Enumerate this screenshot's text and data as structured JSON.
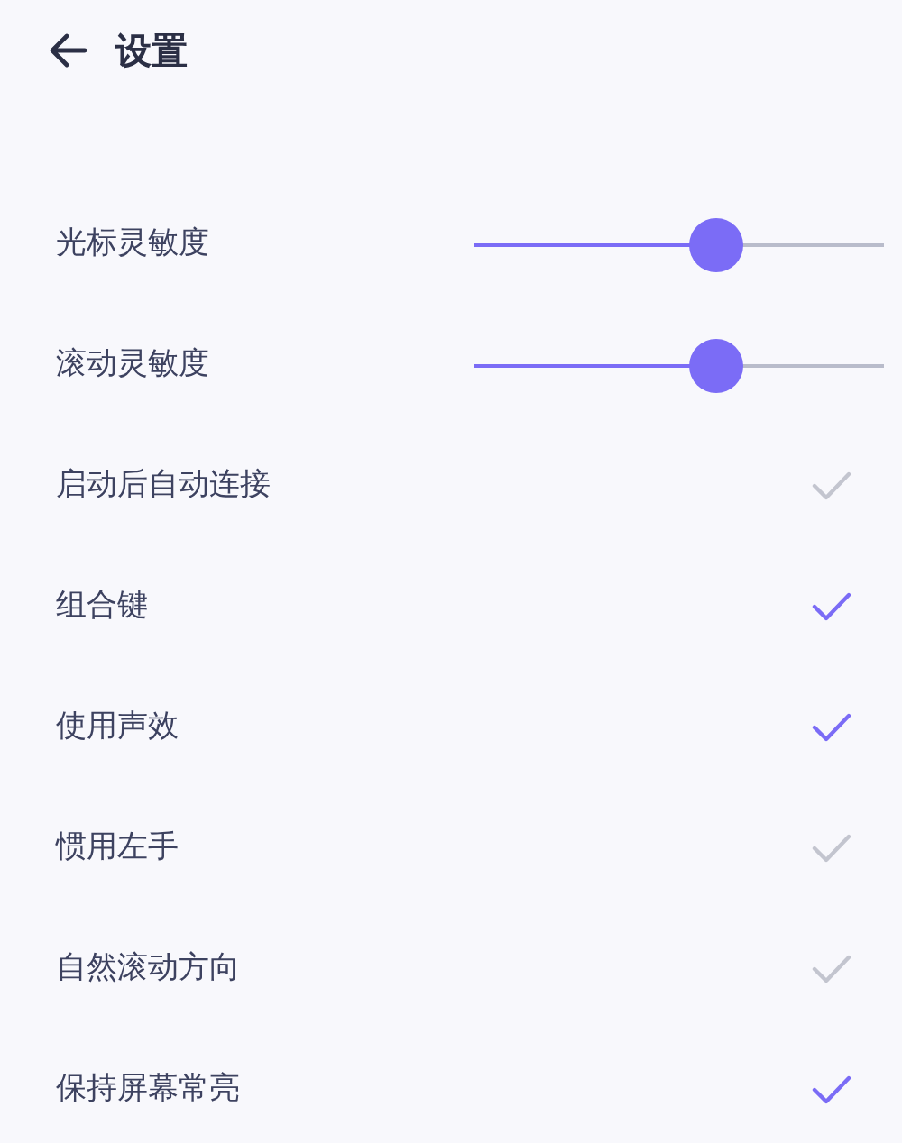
{
  "header": {
    "title": "设置"
  },
  "settings": [
    {
      "kind": "slider",
      "label": "光标灵敏度",
      "level": 0.59
    },
    {
      "kind": "slider",
      "label": "滚动灵敏度",
      "level": 0.59
    },
    {
      "kind": "check",
      "label": "启动后自动连接",
      "checked": false
    },
    {
      "kind": "check",
      "label": "组合键",
      "checked": true
    },
    {
      "kind": "check",
      "label": "使用声效",
      "checked": true
    },
    {
      "kind": "check",
      "label": "惯用左手",
      "checked": false
    },
    {
      "kind": "check",
      "label": "自然滚动方向",
      "checked": false
    },
    {
      "kind": "check",
      "label": "保持屏幕常亮",
      "checked": true
    }
  ]
}
